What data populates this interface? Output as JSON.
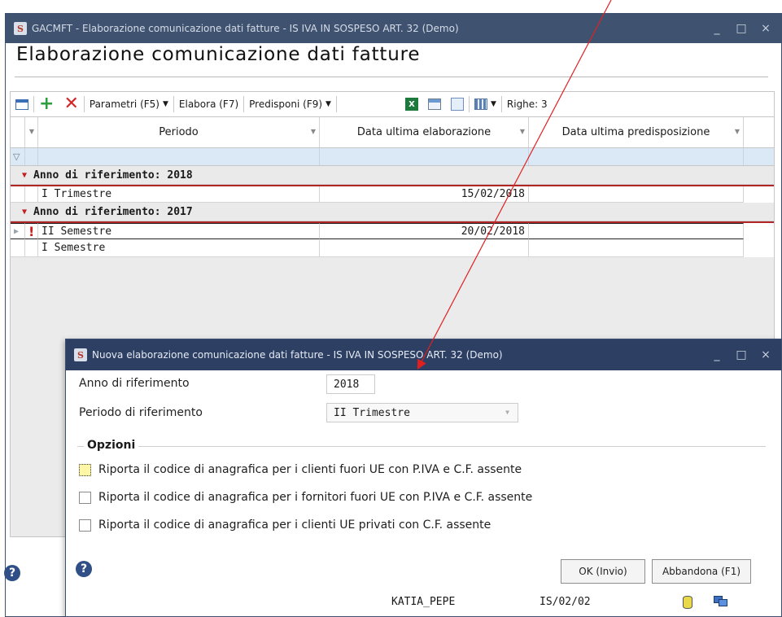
{
  "main_window": {
    "title": "GACMFT - Elaborazione comunicazione dati fatture - IS IVA IN SOSPESO ART. 32  (Demo)",
    "heading": "Elaborazione comunicazione dati fatture",
    "app_icon": "S"
  },
  "window_controls": {
    "minimize": "_",
    "maximize": "□",
    "close": "×"
  },
  "toolbar": {
    "parametri": "Parametri (F5)",
    "elabora": "Elabora (F7)",
    "predisponi": "Predisponi (F9)",
    "righe": "Righe: 3",
    "icons": [
      "grid-view-icon",
      "add-icon",
      "delete-icon",
      "excel-icon",
      "calendar-icon",
      "export-icon",
      "columns-icon"
    ]
  },
  "grid": {
    "columns": [
      "Periodo",
      "Data ultima elaborazione",
      "Data ultima predisposizione"
    ],
    "groups": [
      {
        "label": "Anno di riferimento:  2018",
        "rows": [
          {
            "periodo": "I Trimestre",
            "elaborazione": "15/02/2018",
            "predisposizione": ""
          }
        ]
      },
      {
        "label": "Anno di riferimento:  2017",
        "rows": [
          {
            "periodo": "II Semestre",
            "elaborazione": "20/02/2018",
            "predisposizione": "",
            "warning": "!"
          },
          {
            "periodo": "I Semestre",
            "elaborazione": "",
            "predisposizione": ""
          }
        ]
      }
    ]
  },
  "dialog": {
    "title": "Nuova elaborazione comunicazione dati fatture - IS IVA IN SOSPESO ART. 32  (Demo)",
    "anno_label": "Anno di riferimento",
    "anno_value": "2018",
    "periodo_label": "Periodo di riferimento",
    "periodo_value": "II Trimestre",
    "opzioni_label": "Opzioni",
    "options": [
      "Riporta il codice di anagrafica per i clienti fuori UE con P.IVA e C.F. assente",
      "Riporta il codice di anagrafica per i fornitori fuori UE con P.IVA e C.F. assente",
      "Riporta il codice di anagrafica per i clienti UE privati con C.F. assente"
    ],
    "ok_button": "OK (Invio)",
    "cancel_button": "Abbandona (F1)"
  },
  "status": {
    "user": "KATIA_PEPE",
    "code": "IS/02/02"
  },
  "help_glyph": "?",
  "colors": {
    "titlebar": "#3f5371",
    "dialog_titlebar": "#2d3f63",
    "accent_red": "#c02020",
    "filter_row": "#dbe8f6"
  }
}
